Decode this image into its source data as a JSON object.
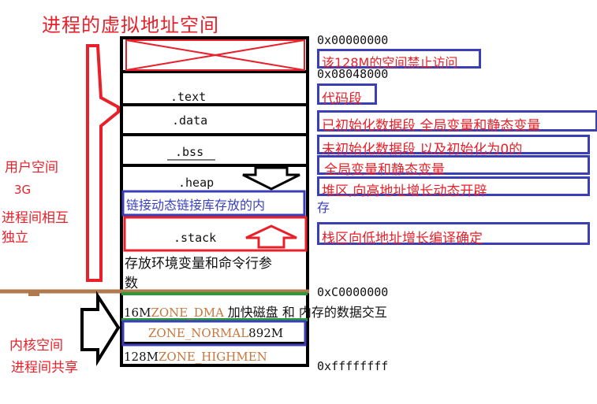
{
  "title": "进程的虚拟地址空间",
  "addresses": {
    "a0": "0x00000000",
    "a1": "0x08048000",
    "a2": "0xC0000000",
    "a3": "0xffffffff"
  },
  "segments": {
    "text": ".text",
    "data": ".data",
    "bss": ".bss",
    "heap": ".heap",
    "stack": ".stack"
  },
  "annotations": {
    "forbidden": "该128M的空间禁止访问",
    "code": "代码段",
    "data": "已初始化数据段 全局变量和静态变量",
    "bss_1": "未初始化数据段 以及初始化为0的",
    "bss_2": "全局变量和静态变量",
    "heap": "堆区,向高地址增长动态开辟",
    "shared_lib_1": "链接动态链接库存放的内",
    "shared_lib_2": "存",
    "stack": "栈区向低地址增长编译确定",
    "env_1": "存放环境变量和命令行参",
    "env_2": "数"
  },
  "kernel": {
    "dma_size": "16M",
    "dma_name": "ZONE_DMA",
    "dma_note": "加快磁盘 和 内存的数据交互",
    "normal_name": "ZONE_NORMAL",
    "normal_size": "892M",
    "high_size": "128M",
    "high_name": "ZONE_HIGHMEN"
  },
  "side_labels": {
    "user_space": "用户空间",
    "user_size": "3G",
    "user_note_1": "进程间相互",
    "user_note_2": "独立",
    "kernel_space": "内核空间",
    "kernel_note": "进程间共享"
  },
  "colors": {
    "red": "#e8202a",
    "blue": "#3a3fb8",
    "green": "#2a9a3a",
    "brown": "#b07a4e",
    "orange_text": "#c8763c"
  }
}
